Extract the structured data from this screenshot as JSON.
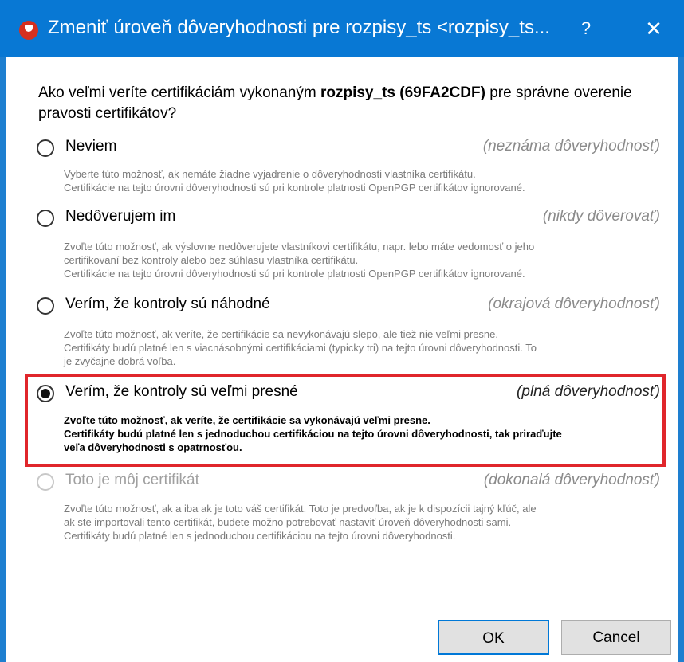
{
  "window": {
    "title": "Zmeniť úroveň dôveryhodnosti pre rozpisy_ts <rozpisy_ts...",
    "help": "?",
    "close": "✕"
  },
  "question": {
    "prefix": "Ako veľmi veríte certifikáciám vykonaným ",
    "bold": "rozpisy_ts (69FA2CDF)",
    "suffix": " pre správne overenie pravosti certifikátov?"
  },
  "options": [
    {
      "label": "Neviem",
      "level": "(neznáma dôveryhodnosť)",
      "desc": [
        "Vyberte túto možnosť, ak nemáte žiadne vyjadrenie o dôveryhodnosti vlastníka certifikátu.",
        "Certifikácie na tejto úrovni dôveryhodnosti sú pri kontrole platnosti OpenPGP certifikátov ignorované."
      ],
      "checked": false,
      "enabled": true
    },
    {
      "label": "Nedôverujem im",
      "level": "(nikdy dôverovať)",
      "desc": [
        "Zvoľte túto možnosť, ak výslovne nedôverujete vlastníkovi certifikátu, napr. lebo máte vedomosť o jeho",
        "certifikovaní bez kontroly alebo bez súhlasu vlastníka certifikátu.",
        "Certifikácie na tejto úrovni dôveryhodnosti sú pri kontrole platnosti OpenPGP certifikátov ignorované."
      ],
      "checked": false,
      "enabled": true
    },
    {
      "label": "Verím, že kontroly sú náhodné",
      "level": "(okrajová dôveryhodnosť)",
      "desc": [
        "Zvoľte túto možnosť, ak veríte, že certifikácie sa nevykonávajú slepo, ale tiež nie veľmi presne.",
        "Certifikáty budú platné len s viacnásobnými certifikáciami (typicky tri) na tejto úrovni dôveryhodnosti. To",
        "je zvyčajne dobrá voľba."
      ],
      "checked": false,
      "enabled": true
    },
    {
      "label": "Verím, že kontroly sú veľmi presné",
      "level": "(plná dôveryhodnosť)",
      "desc": [
        "Zvoľte túto možnosť, ak veríte, že certifikácie sa vykonávajú veľmi presne.",
        "Certifikáty budú platné len s jednoduchou certifikáciou na tejto úrovni dôveryhodnosti, tak priraďujte",
        "veľa dôveryhodnosti s opatrnosťou."
      ],
      "checked": true,
      "enabled": true
    },
    {
      "label": "Toto je môj certifikát",
      "level": "(dokonalá dôveryhodnosť)",
      "desc": [
        "Zvoľte túto možnosť, ak a iba ak je toto váš certifikát. Toto je predvoľba, ak je k dispozícii tajný kľúč, ale",
        "ak ste importovali tento certifikát, budete možno potrebovať nastaviť úroveň dôveryhodnosti sami.",
        "Certifikáty budú platné len s jednoduchou certifikáciou na tejto úrovni dôveryhodnosti."
      ],
      "checked": false,
      "enabled": false
    }
  ],
  "buttons": {
    "ok": "OK",
    "cancel": "Cancel"
  },
  "colors": {
    "titlebar": "#0878d4",
    "highlight": "#e0262b",
    "default_button_border": "#0078d7"
  }
}
